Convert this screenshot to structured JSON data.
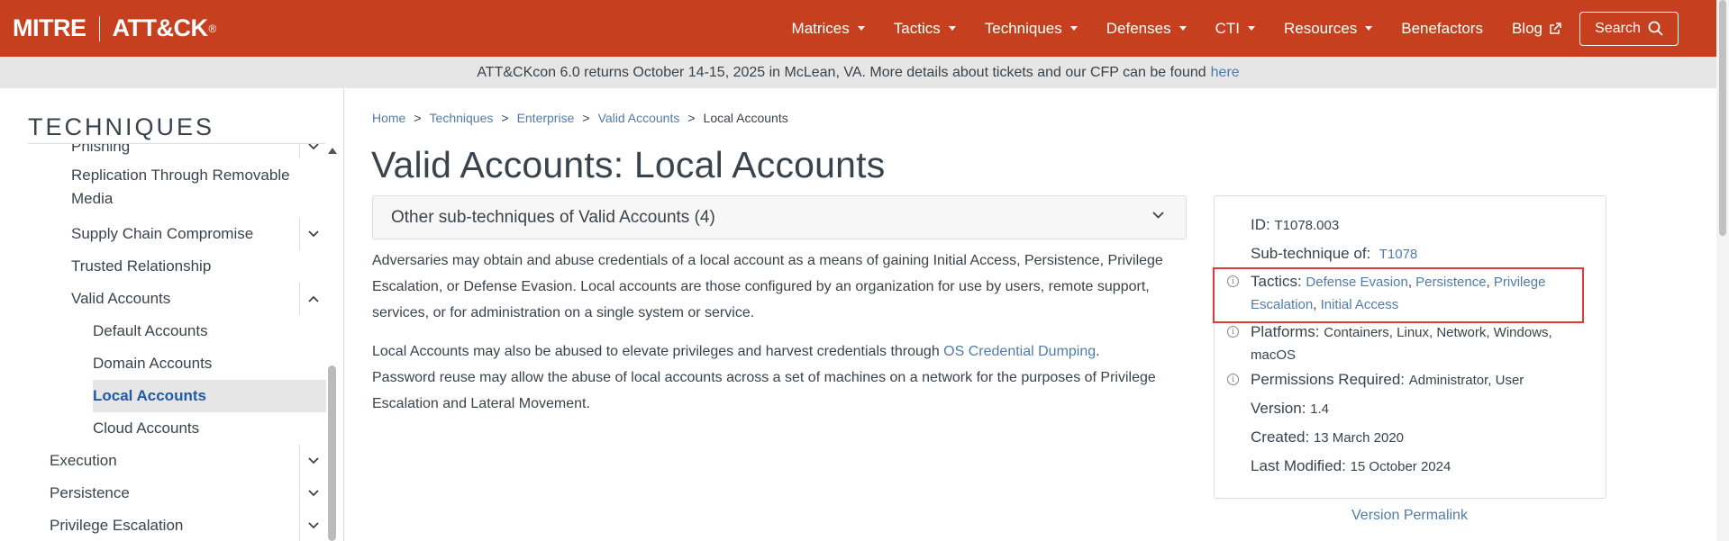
{
  "header": {
    "logo_left": "MITRE",
    "logo_right": "ATT&CK",
    "logo_reg": "®",
    "nav": [
      {
        "label": "Matrices",
        "dropdown": true
      },
      {
        "label": "Tactics",
        "dropdown": true
      },
      {
        "label": "Techniques",
        "dropdown": true
      },
      {
        "label": "Defenses",
        "dropdown": true
      },
      {
        "label": "CTI",
        "dropdown": true
      },
      {
        "label": "Resources",
        "dropdown": true
      },
      {
        "label": "Benefactors",
        "dropdown": false
      },
      {
        "label": "Blog",
        "dropdown": false,
        "external": true
      }
    ],
    "search_label": "Search",
    "colors": {
      "brand": "#c63f1f"
    }
  },
  "banner": {
    "text": "ATT&CKcon 6.0 returns October 14-15, 2025 in McLean, VA. More details about tickets and our CFP can be found",
    "link": "here"
  },
  "sidebar": {
    "title": "TECHNIQUES",
    "items": [
      {
        "label": "Phishing",
        "chevron": "down"
      },
      {
        "label": "Replication Through Removable Media",
        "chevron": ""
      },
      {
        "label": "Supply Chain Compromise",
        "chevron": "down"
      },
      {
        "label": "Trusted Relationship",
        "chevron": ""
      },
      {
        "label": "Valid Accounts",
        "chevron": "up"
      },
      {
        "label": "Default Accounts",
        "chevron": ""
      },
      {
        "label": "Domain Accounts",
        "chevron": ""
      },
      {
        "label": "Local Accounts",
        "chevron": "",
        "active": true
      },
      {
        "label": "Cloud Accounts",
        "chevron": ""
      },
      {
        "label": "Execution",
        "chevron": "down"
      },
      {
        "label": "Persistence",
        "chevron": "down"
      },
      {
        "label": "Privilege Escalation",
        "chevron": "down"
      }
    ]
  },
  "breadcrumb": [
    "Home",
    "Techniques",
    "Enterprise",
    "Valid Accounts",
    "Local Accounts"
  ],
  "breadcrumb_sep": ">",
  "page_title": "Valid Accounts: Local Accounts",
  "subtechniques_label": "Other sub-techniques of Valid Accounts (4)",
  "description": {
    "p1": "Adversaries may obtain and abuse credentials of a local account as a means of gaining Initial Access, Persistence, Privilege Escalation, or Defense Evasion. Local accounts are those configured by an organization for use by users, remote support, services, or for administration on a single system or service.",
    "p2_before": "Local Accounts may also be abused to elevate privileges and harvest credentials through",
    "p2_link": "OS Credential Dumping",
    "p2_after": ". Password reuse may allow the abuse of local accounts across a set of machines on a network for the purposes of Privilege Escalation and Lateral Movement."
  },
  "card": {
    "id_label": "ID:",
    "id_value": "T1078.003",
    "subtech_label": "Sub-technique of:",
    "subtech_value": "T1078",
    "tactics_label": "Tactics:",
    "tactics": [
      "Defense Evasion",
      "Persistence",
      "Privilege",
      "Escalation",
      "Initial Access"
    ],
    "platforms_label": "Platforms:",
    "platforms_line1": "Containers, Linux, Network, Windows,",
    "platforms_line2": "macOS",
    "permissions_label": "Permissions Required:",
    "permissions_value": "Administrator, User",
    "version_label": "Version:",
    "version_value": "1.4",
    "created_label": "Created:",
    "created_value": "13 March 2020",
    "modified_label": "Last Modified:",
    "modified_value": "15 October 2024",
    "permalink": "Version Permalink",
    "info_glyph": "i",
    "comma": ", "
  }
}
